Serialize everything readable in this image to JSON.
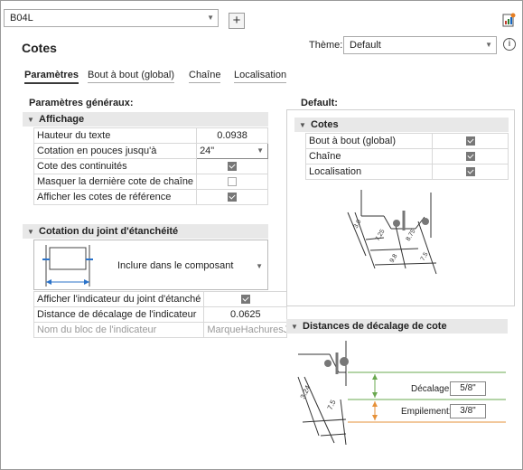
{
  "header": {
    "profile_value": "B04L",
    "add_label": "+",
    "title": "Cotes",
    "theme_label": "Thème:",
    "theme_value": "Default",
    "info_label": "i"
  },
  "tabs": [
    {
      "label": "Paramètres",
      "active": true
    },
    {
      "label": "Bout à bout (global)",
      "active": false
    },
    {
      "label": "Chaîne",
      "active": false
    },
    {
      "label": "Localisation",
      "active": false
    }
  ],
  "general": {
    "title": "Paramètres généraux:",
    "affichage": {
      "title": "Affichage",
      "rows": [
        {
          "label": "Hauteur du texte",
          "value": "0.0938"
        },
        {
          "label": "Cotation en pouces jusqu'à",
          "value": "24\""
        },
        {
          "label": "Cote des continuités",
          "checked": true
        },
        {
          "label": "Masquer la dernière cote de chaîne",
          "checked": false
        },
        {
          "label": "Afficher les cotes de référence",
          "checked": true
        }
      ]
    },
    "joint": {
      "title": "Cotation du joint d'étanchéité",
      "option_value": "Inclure dans le composant",
      "rows": [
        {
          "label": "Afficher l'indicateur du joint d'étanché",
          "checked": true
        },
        {
          "label": "Distance de décalage de l'indicateur",
          "value": "0.0625"
        },
        {
          "label": "Nom du bloc de l'indicateur",
          "value": "MarqueHachuresJoin",
          "disabled": true
        }
      ]
    }
  },
  "default_panel": {
    "title": "Default:",
    "cotes": {
      "title": "Cotes",
      "rows": [
        {
          "label": "Bout à bout (global)",
          "checked": true
        },
        {
          "label": "Chaîne",
          "checked": true
        },
        {
          "label": "Localisation",
          "checked": true
        }
      ]
    },
    "diagram_labels": [
      "3.0",
      "7.25",
      "8.75",
      "9.8",
      "7.5"
    ]
  },
  "offset": {
    "title": "Distances de décalage de cote",
    "decalage_label": "Décalage:",
    "decalage_value": "5/8\"",
    "empilement_label": "Empilement:",
    "empilement_value": "3/8\"",
    "diagram_labels": [
      "3.24",
      "7.5"
    ],
    "colors": {
      "green": "#6aa84f",
      "orange": "#e69138"
    }
  }
}
